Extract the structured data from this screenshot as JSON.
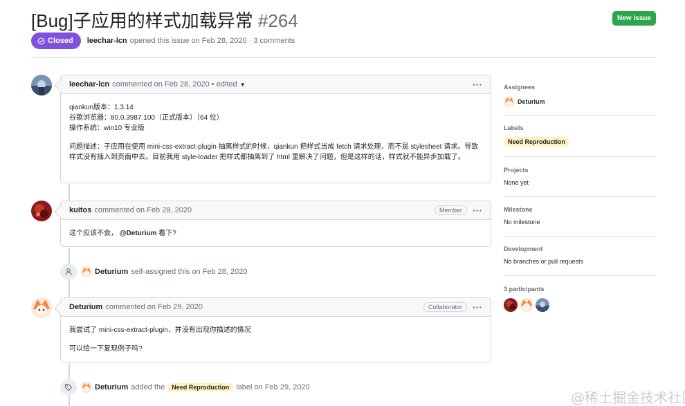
{
  "issue": {
    "title": "[Bug]子应用的样式加载异常",
    "number": "#264",
    "new_issue_label": "New issue",
    "state": "Closed",
    "author": "leechar-lcn",
    "opened_text": "opened this issue on Feb 28, 2020 · 3 comments"
  },
  "timeline": {
    "comment1": {
      "author": "leechar-lcn",
      "meta": "commented on Feb 28, 2020 • edited",
      "lines": [
        "qiankun版本：1.3.14",
        "谷歌浏览器：80.0.3987.100（正式版本）（64 位）",
        "操作系统：win10 专业版"
      ],
      "desc": "问题描述：子应用在使用 mini-css-extract-plugin 抽离样式的时候，qiankun 把样式当成 fetch 请求处理，而不是 stylesheet 请求。导致样式没有插入到页面中去。目前我用 style-loader 把样式都抽离到了 html 里解决了问题，但是这样的话，样式就不能异步加载了。"
    },
    "comment2": {
      "author": "kuitos",
      "meta": "commented on Feb 28, 2020",
      "role": "Member",
      "text_before": "这个应该不会，",
      "mention": "@Deturium",
      "text_after": " 看下?"
    },
    "event1": {
      "actor": "Deturium",
      "text": "self-assigned this on Feb 28, 2020"
    },
    "comment3": {
      "author": "Deturium",
      "meta": "commented on Feb 29, 2020",
      "role": "Collaborator",
      "p1": "我尝试了 mini-css-extract-plugin，并没有出现你描述的情况",
      "p2": "可以给一下复现例子吗?"
    },
    "event2": {
      "actor": "Deturium",
      "text_before": "added the",
      "label": "Need Reproduction",
      "text_after": "label on Feb 29, 2020"
    }
  },
  "sidebar": {
    "assignees": {
      "heading": "Assignees",
      "value": "Deturium"
    },
    "labels": {
      "heading": "Labels",
      "value": "Need Reproduction"
    },
    "projects": {
      "heading": "Projects",
      "value": "None yet"
    },
    "milestone": {
      "heading": "Milestone",
      "value": "No milestone"
    },
    "development": {
      "heading": "Development",
      "value": "No branches or pull requests"
    },
    "participants": {
      "heading": "3 participants"
    }
  },
  "colors": {
    "closed_badge": "#8250df",
    "new_issue_button": "#2da44e",
    "label_bg": "#fef2c0"
  },
  "watermark": "@稀土掘金技术社区"
}
